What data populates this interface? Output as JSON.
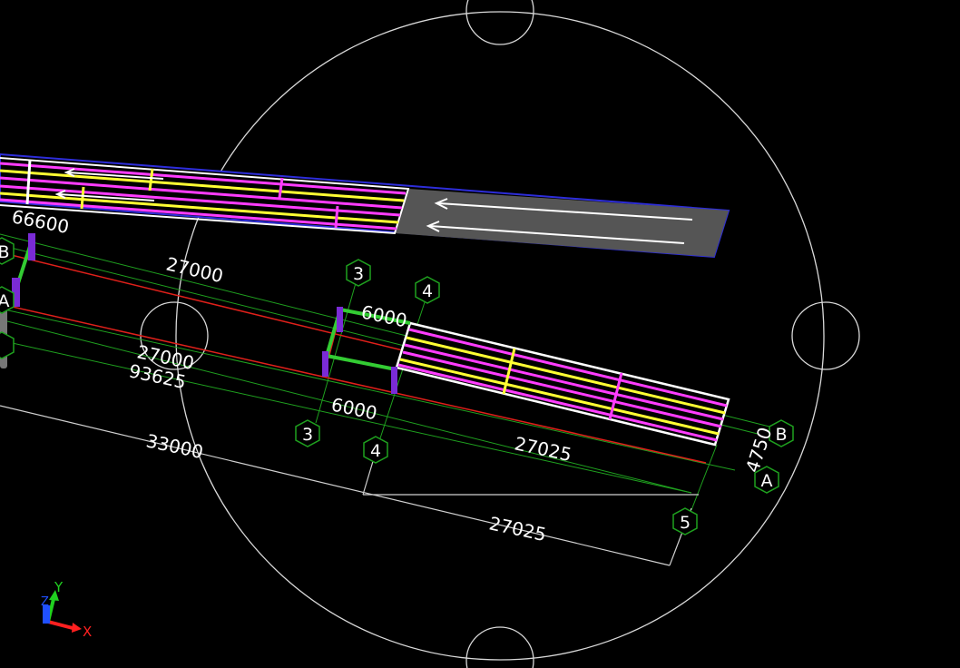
{
  "colors": {
    "background": "#000000",
    "guide_circle": "#d9d9d9",
    "grid_line": "#1fa11f",
    "grid_bubble": "#1fa11f",
    "dimension_line": "#cfcfcf",
    "beam_red": "#e0201a",
    "deck_outline": "#ffffff",
    "rail_magenta": "#ff3cff",
    "rail_yellow": "#ffff33",
    "member_green": "#33cc33",
    "column_purple": "#7a2bd6",
    "road_fill": "#555555",
    "road_edge": "#2d2dd9",
    "axis_x": "#ff2020",
    "axis_y": "#20d020",
    "axis_z": "#2050ff"
  },
  "grid_labels": {
    "top_3": "3",
    "top_4": "4",
    "bottom_3": "3",
    "bottom_4": "4",
    "right_B": "B",
    "right_A": "A",
    "bottom_5": "5",
    "left_B": "B",
    "left_A": "A"
  },
  "dimensions": {
    "d66600": "66600",
    "d27000_top": "27000",
    "d6000_top": "6000",
    "d27000_mid": "27000",
    "d93625": "93625",
    "d6000_bottom": "6000",
    "d33000": "33000",
    "d27025_mid": "27025",
    "d27025_bottom": "27025",
    "d4750": "4750"
  },
  "axis_triad": {
    "x_label": "X",
    "y_label": "Y",
    "z_label": "Z"
  }
}
